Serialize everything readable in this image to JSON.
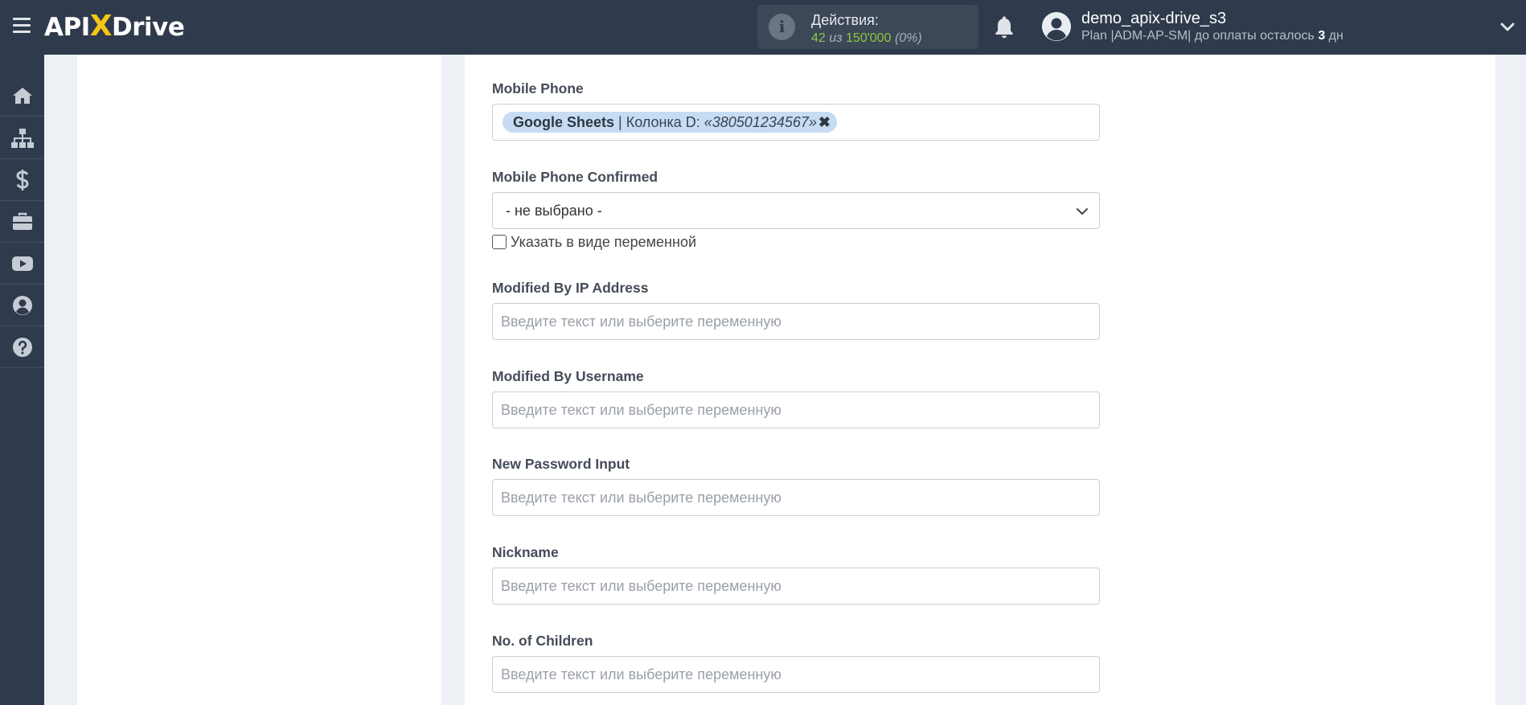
{
  "header": {
    "logo_prefix": "API",
    "logo_x": "X",
    "logo_suffix": "Drive",
    "actions_title": "Действия:",
    "actions_used": "42",
    "actions_sep": " из ",
    "actions_total": "150'000",
    "actions_percent": "(0%)",
    "user_name": "demo_apix-drive_s3",
    "plan_text": "Plan |ADM-AP-SM| до оплаты осталось ",
    "plan_days": "3",
    "plan_days_unit": " дн"
  },
  "sidebar": {
    "items": [
      {
        "icon": "home-icon"
      },
      {
        "icon": "sitemap-icon"
      },
      {
        "icon": "dollar-icon"
      },
      {
        "icon": "briefcase-icon"
      },
      {
        "icon": "youtube-icon"
      },
      {
        "icon": "user-circle-icon"
      },
      {
        "icon": "question-icon"
      }
    ]
  },
  "form": {
    "mobile_phone": {
      "label": "Mobile Phone",
      "tag_source": "Google Sheets",
      "tag_sep": " | Колонка D: ",
      "tag_value": "«380501234567»",
      "tag_remove": "✖"
    },
    "mobile_phone_confirmed": {
      "label": "Mobile Phone Confirmed",
      "selected": "- не выбрано -",
      "checkbox_label": "Указать в виде переменной"
    },
    "modified_by_ip": {
      "label": "Modified By IP Address",
      "placeholder": "Введите текст или выберите переменную"
    },
    "modified_by_username": {
      "label": "Modified By Username",
      "placeholder": "Введите текст или выберите переменную"
    },
    "new_password_input": {
      "label": "New Password Input",
      "placeholder": "Введите текст или выберите переменную"
    },
    "nickname": {
      "label": "Nickname",
      "placeholder": "Введите текст или выберите переменную"
    },
    "no_of_children": {
      "label": "No. of Children",
      "placeholder": "Введите текст или выберите переменную"
    }
  },
  "colors": {
    "topbar": "#2f3b4c",
    "background": "#edf0f5",
    "accent_green": "#8dc63f",
    "logo_yellow": "#f5c518",
    "tag_bg": "#c5dcf3"
  }
}
